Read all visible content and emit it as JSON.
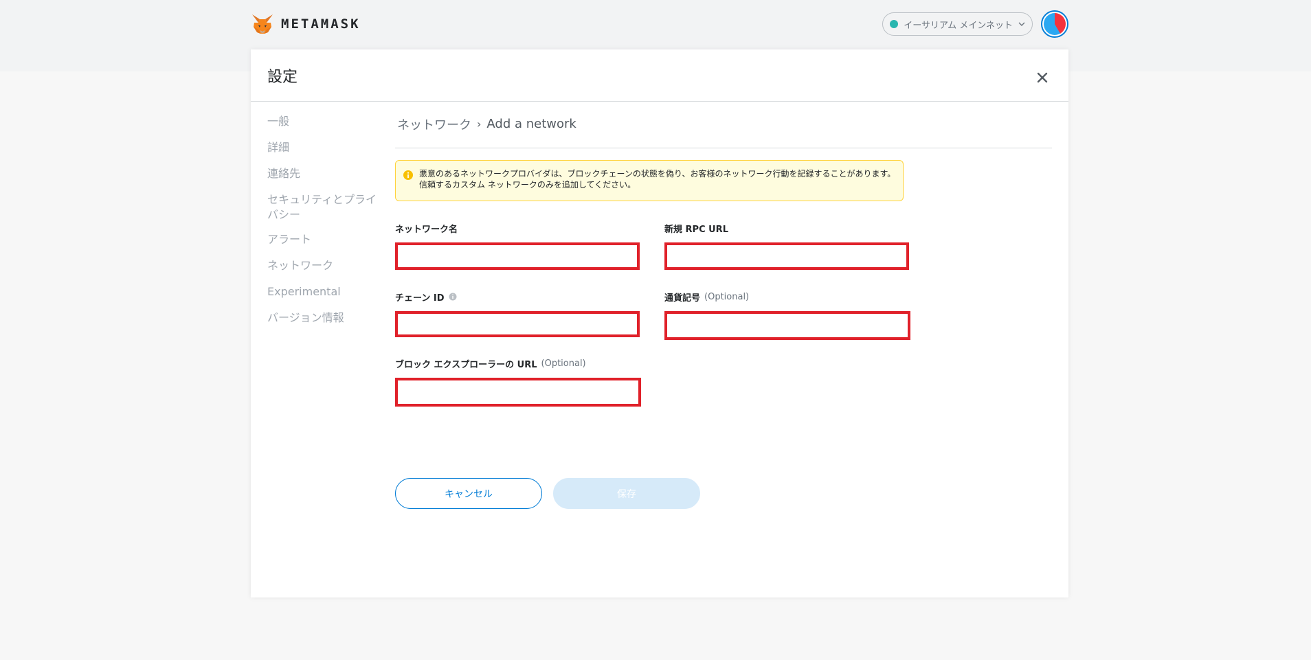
{
  "header": {
    "brand": "METAMASK",
    "network": "イーサリアム メインネット",
    "colors": {
      "network_dot": "#29b6af",
      "accent": "#037dd6"
    }
  },
  "settings": {
    "title": "設定",
    "sidebar": {
      "items": [
        {
          "label": "一般"
        },
        {
          "label": "詳細"
        },
        {
          "label": "連絡先"
        },
        {
          "label": "セキュリティとプライバシー"
        },
        {
          "label": "アラート"
        },
        {
          "label": "ネットワーク"
        },
        {
          "label": "Experimental"
        },
        {
          "label": "バージョン情報"
        }
      ]
    },
    "breadcrumb": {
      "root": "ネットワーク",
      "separator": "›",
      "current": "Add a network"
    },
    "warning": {
      "icon": "info-circle-icon",
      "text": "悪意のあるネットワークプロバイダは、ブロックチェーンの状態を偽り、お客様のネットワーク行動を記録することがあります。信頼するカスタム ネットワークのみを追加してください。"
    },
    "form": {
      "network_name": {
        "label": "ネットワーク名",
        "value": ""
      },
      "rpc_url": {
        "label": "新規 RPC URL",
        "value": ""
      },
      "chain_id": {
        "label": "チェーン ID",
        "value": ""
      },
      "currency_symbol": {
        "label": "通貨記号",
        "optional": "(Optional)",
        "value": ""
      },
      "block_explorer": {
        "label": "ブロック エクスプローラーの URL",
        "optional": "(Optional)",
        "value": ""
      }
    },
    "buttons": {
      "cancel": "キャンセル",
      "save": "保存"
    }
  }
}
